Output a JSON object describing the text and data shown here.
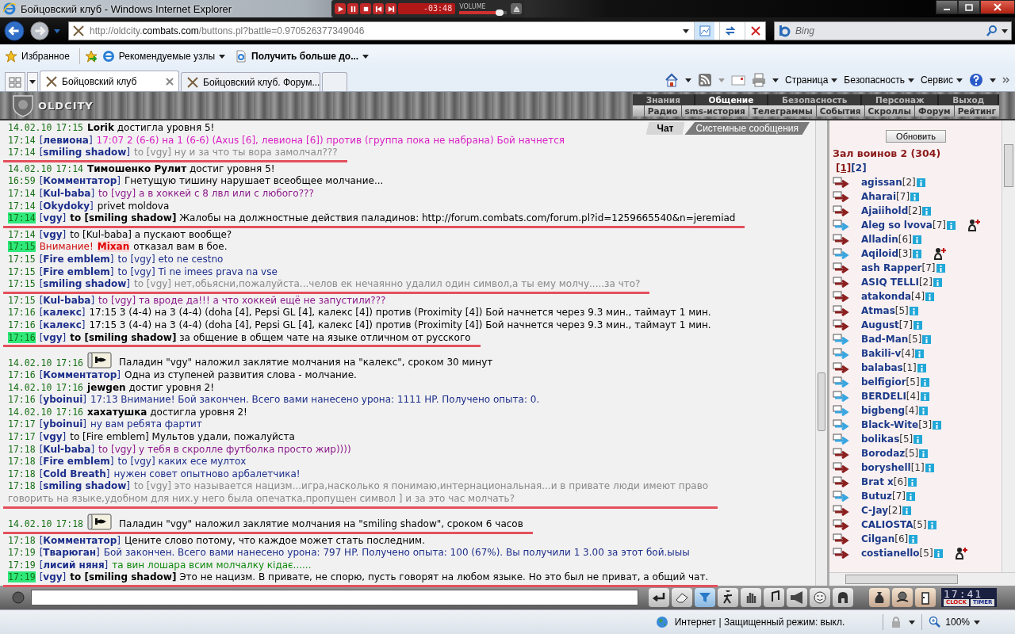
{
  "window": {
    "title": "Бойцовский клуб - Windows Internet Explorer"
  },
  "media_player": {
    "time": "-03:48",
    "volume_label": "VOLUME",
    "level": 0.85
  },
  "address_bar": {
    "url": "http://oldcity.**combats.com**/buttons.pl?battle=0.970526377349046",
    "search_placeholder": "Bing"
  },
  "favorites_bar": [
    {
      "label": "Избранное",
      "kind": "favorites"
    },
    {
      "label": "Рекомендуемые узлы",
      "kind": "sites"
    },
    {
      "label": "Получить больше до...",
      "kind": "more"
    }
  ],
  "tabs": [
    {
      "label": "Бойцовский клуб",
      "selected": true
    },
    {
      "label": "Бойцовский клуб. Форум...",
      "selected": false
    }
  ],
  "command_bar": [
    "Страница",
    "Безопасность",
    "Сервис"
  ],
  "game_header": {
    "logo": "OLDCITY",
    "menu": [
      {
        "label": "Знания",
        "selected": false
      },
      {
        "label": "Общение",
        "selected": true
      },
      {
        "label": "Безопасность",
        "selected": false
      },
      {
        "label": "Персонаж",
        "selected": false
      },
      {
        "label": "Выход",
        "selected": false
      }
    ],
    "submenu": [
      "Радио",
      "sms-история",
      "Телеграммы",
      "События",
      "Скроллы",
      "Форум",
      "Рейтинг"
    ]
  },
  "chat": {
    "tabs": [
      {
        "label": "Чат",
        "selected": true
      },
      {
        "label": "Системные сообщения",
        "selected": false
      }
    ],
    "lines": [
      {
        "date": "14.02.10",
        "time": "17:15",
        "text": "**Lorik** достигла уровня 5!",
        "color": "#000000"
      },
      {
        "time": "17:14",
        "author": "[**левиона**]",
        "text": "17:07 2 (6-6) на 1 (6-6) (Axus [6], левиона [6]) против (группа пока не набрана) Бой начнется",
        "color": "#d81fc4"
      },
      {
        "time": "17:14",
        "author": "[**smiling shadow**]",
        "text": "to [vgy] ну и за что ты вора замолчал???",
        "color": "#8a8a8a",
        "marked": true
      },
      {
        "date": "14.02.10",
        "time": "17:14",
        "text": "**Тимошенко Рулит** достиг уровня 5!",
        "color": "#000000"
      },
      {
        "time": "16:59",
        "author": "[**Комментатор**]",
        "text": "Гнетущую тишину нарушает всеобщее молчание...",
        "color": "#000000"
      },
      {
        "time": "17:14",
        "author": "[**Kul-baba**]",
        "text": "to [vgy] а в хоккей с 8 лвл или с любого???",
        "color": "#8b1a8b"
      },
      {
        "time": "17:14",
        "author": "[**Okydoky**]",
        "text": "privet moldova",
        "color": "#000000"
      },
      {
        "time": "17:14",
        "highlight": true,
        "author": "[**vgy**]",
        "text": "**to [smiling shadow]** Жалобы на должностные действия паладинов: http://forum.combats.com/forum.pl?id=1259665540&n=jeremiad",
        "color": "#000000",
        "marked": true
      },
      {
        "time": "17:14",
        "author": "[**vgy**]",
        "text": "to [Kul-baba] а пускают вообще?",
        "color": "#000000"
      },
      {
        "time": "17:15",
        "highlight": true,
        "kind": "warning",
        "label": "Внимание!",
        "name": "Mixan",
        "text": "отказал вам в бое.",
        "color": "#000000"
      },
      {
        "time": "17:15",
        "author": "[**Fire emblem**]",
        "text": "to [vgy] eto ne cestno",
        "color": "#1c2f8c"
      },
      {
        "time": "17:15",
        "author": "[**Fire emblem**]",
        "text": "to [vgy] Ti ne imees prava na vse",
        "color": "#1c2f8c"
      },
      {
        "time": "17:15",
        "author": "[**smiling shadow**]",
        "text": "to [vgy] нет,обьясни,пожалуйста...челов ек нечаянно удалил один символ,а ты ему молчу.....за что?",
        "color": "#8a8a8a",
        "marked": true
      },
      {
        "time": "17:15",
        "author": "[**Kul-baba**]",
        "text": "to [vgy] та вроде да!!! а что хоккей ещё не запустили???",
        "color": "#8b1a8b"
      },
      {
        "time": "17:16",
        "author": "[**калекс**]",
        "text": "17:15 3 (4-4) на 3 (4-4) (doha [4], Pepsi GL [4], калекс [4]) против (Proximity [4]) Бой начнется через 9.3 мин., таймаут 1 мин.",
        "color": "#000000"
      },
      {
        "time": "17:16",
        "author": "[**калекс**]",
        "text": "17:15 3 (4-4) на 3 (4-4) (doha [4], Pepsi GL [4], калекс [4]) против (Proximity [4]) Бой начнется через 9.3 мин., таймаут 1 мин.",
        "color": "#000000"
      },
      {
        "time": "17:16",
        "highlight": true,
        "author": "[**vgy**]",
        "text": "**to [smiling shadow]** за общение в общем чате на языке отличном от русского",
        "color": "#000000",
        "marked": true
      },
      {
        "date": "14.02.10",
        "time": "17:16",
        "kind": "paladin",
        "text": "Паладин \"vgy\" наложил заклятие молчания на \"калекс\", сроком 30 минут",
        "color": "#000000"
      },
      {
        "time": "17:16",
        "author": "[**Комментатор**]",
        "text": "Одна из ступеней развития слова - молчание.",
        "color": "#000000"
      },
      {
        "date": "14.02.10",
        "time": "17:16",
        "text": "**jewgen** достиг уровня 2!",
        "color": "#000000"
      },
      {
        "time": "17:16",
        "author": "[**yboinui**]",
        "text": "17:13 Внимание! Бой закончен. Всего вами нанесено урона: 1111 HP. Получено опыта: 0.",
        "color": "#1c2f8c"
      },
      {
        "date": "14.02.10",
        "time": "17:16",
        "text": "**хахатушка** достигла уровня 2!",
        "color": "#000000"
      },
      {
        "time": "17:17",
        "author": "[**yboinui**]",
        "text": "ну вам ребята фартит",
        "color": "#1c2f8c"
      },
      {
        "time": "17:17",
        "author": "[**vgy**]",
        "text": "to [Fire emblem] Мультов удали, пожалуйста",
        "color": "#000000"
      },
      {
        "time": "17:18",
        "author": "[**Kul-baba**]",
        "text": "to [vgy] у тебя в скролле футболка просто жир))))",
        "color": "#8b1a8b"
      },
      {
        "time": "17:18",
        "author": "[**Fire emblem**]",
        "text": "to [vgy] каких есе мултох",
        "color": "#1c2f8c"
      },
      {
        "time": "17:18",
        "author": "[**Cold Breath**]",
        "text": "нужен совет опытново арбалетчика!",
        "color": "#1c2f8c"
      },
      {
        "time": "17:18",
        "author": "[**smiling shadow**]",
        "text": "to [vgy] это называется нацизм...игра,насколько я понимаю,интернациональная...и в привате люди имеют право",
        "continuation": "говорить на языке,удобном для них.у него была опечатка,пропущен символ ] и за это час молчать?",
        "color": "#8a8a8a",
        "marked": true
      },
      {
        "date": "14.02.10",
        "time": "17:18",
        "kind": "paladin",
        "text": "Паладин \"vgy\" наложил заклятие молчания на \"smiling shadow\", сроком 6 часов",
        "color": "#000000",
        "marked": true
      },
      {
        "time": "17:18",
        "author": "[**Комментатор**]",
        "text": "Цените слово потому, что каждое может стать последним.",
        "color": "#000000"
      },
      {
        "time": "17:19",
        "author": "[**Тварюган**]",
        "text": "Бой закончен. Всего вами нанесено урона: 797 HP. Получено опыта: 100 (67%). Вы получили 1 3.00 за этот бой.ыыы",
        "color": "#1c2f8c"
      },
      {
        "time": "17:19",
        "author": "[**лисий няня**]",
        "text": "та вин лошара всим молчалку кідає......",
        "color": "#118a11"
      },
      {
        "time": "17:19",
        "highlight": true,
        "author": "[**vgy**]",
        "text": "**to [smiling shadow]** Это не нацизм. В привате, не спорю, пусть говорят на любом языке. Но это был не приват, а общий чат.",
        "color": "#000000",
        "marked": true
      }
    ]
  },
  "room": {
    "refresh_button": "Обновить",
    "title": "Зал воинов 2 (304)",
    "pages": [
      {
        "label": "[1]",
        "selected": true
      },
      {
        "label": "[2]",
        "selected": false
      }
    ],
    "users": [
      {
        "name": "agissan",
        "level": "[2]",
        "color": "#8b2020"
      },
      {
        "name": "Aharai",
        "level": "[7]",
        "color": "#8b2020"
      },
      {
        "name": "Ajaiihold",
        "level": "[2]",
        "color": "#8b2020"
      },
      {
        "name": "Aleg so lvova",
        "level": "[7]",
        "color": "#3aa6e0",
        "invite": true
      },
      {
        "name": "Alladin",
        "level": "[6]",
        "color": "#8b2020"
      },
      {
        "name": "Aqiloid",
        "level": "[3]",
        "color": "#3aa6e0",
        "invite": true
      },
      {
        "name": "ash Rapper",
        "level": "[7]",
        "color": "#8b2020"
      },
      {
        "name": "ASIQ TELLI",
        "level": "[2]",
        "color": "#8b2020"
      },
      {
        "name": "atakonda",
        "level": "[4]",
        "color": "#8b2020"
      },
      {
        "name": "Atmas",
        "level": "[5]",
        "color": "#8b2020"
      },
      {
        "name": "August",
        "level": "[7]",
        "color": "#8b2020"
      },
      {
        "name": "Bad-Man",
        "level": "[5]",
        "color": "#3aa6e0"
      },
      {
        "name": "Bakili-v",
        "level": "[4]",
        "color": "#3aa6e0"
      },
      {
        "name": "balabas",
        "level": "[1]",
        "color": "#8b2020"
      },
      {
        "name": "belfigior",
        "level": "[5]",
        "color": "#3aa6e0"
      },
      {
        "name": "BERDELI",
        "level": "[4]",
        "color": "#3aa6e0"
      },
      {
        "name": "bigbeng",
        "level": "[4]",
        "color": "#3aa6e0"
      },
      {
        "name": "Black-Wite",
        "level": "[3]",
        "color": "#3aa6e0"
      },
      {
        "name": "bolikas",
        "level": "[5]",
        "color": "#3aa6e0"
      },
      {
        "name": "Borodaz",
        "level": "[5]",
        "color": "#8b2020"
      },
      {
        "name": "boryshell",
        "level": "[1]",
        "color": "#8b2020"
      },
      {
        "name": "Brat x",
        "level": "[6]",
        "color": "#8b2020"
      },
      {
        "name": "Butuz",
        "level": "[7]",
        "color": "#3aa6e0"
      },
      {
        "name": "C-Jay",
        "level": "[2]",
        "color": "#8b2020"
      },
      {
        "name": "CALIOSTA",
        "level": "[5]",
        "color": "#8b2020"
      },
      {
        "name": "Cilgan",
        "level": "[6]",
        "color": "#8b2020"
      },
      {
        "name": "costianello",
        "level": "[5]",
        "color": "#8b2020",
        "invite": true
      }
    ]
  },
  "bottom_bar": {
    "clock": "17:41",
    "clock_label": "CLOCK",
    "timer_label": "TIMER"
  },
  "status_bar": {
    "zone": "Интернет | Защищенный режим: выкл.",
    "zoom": "100%"
  }
}
